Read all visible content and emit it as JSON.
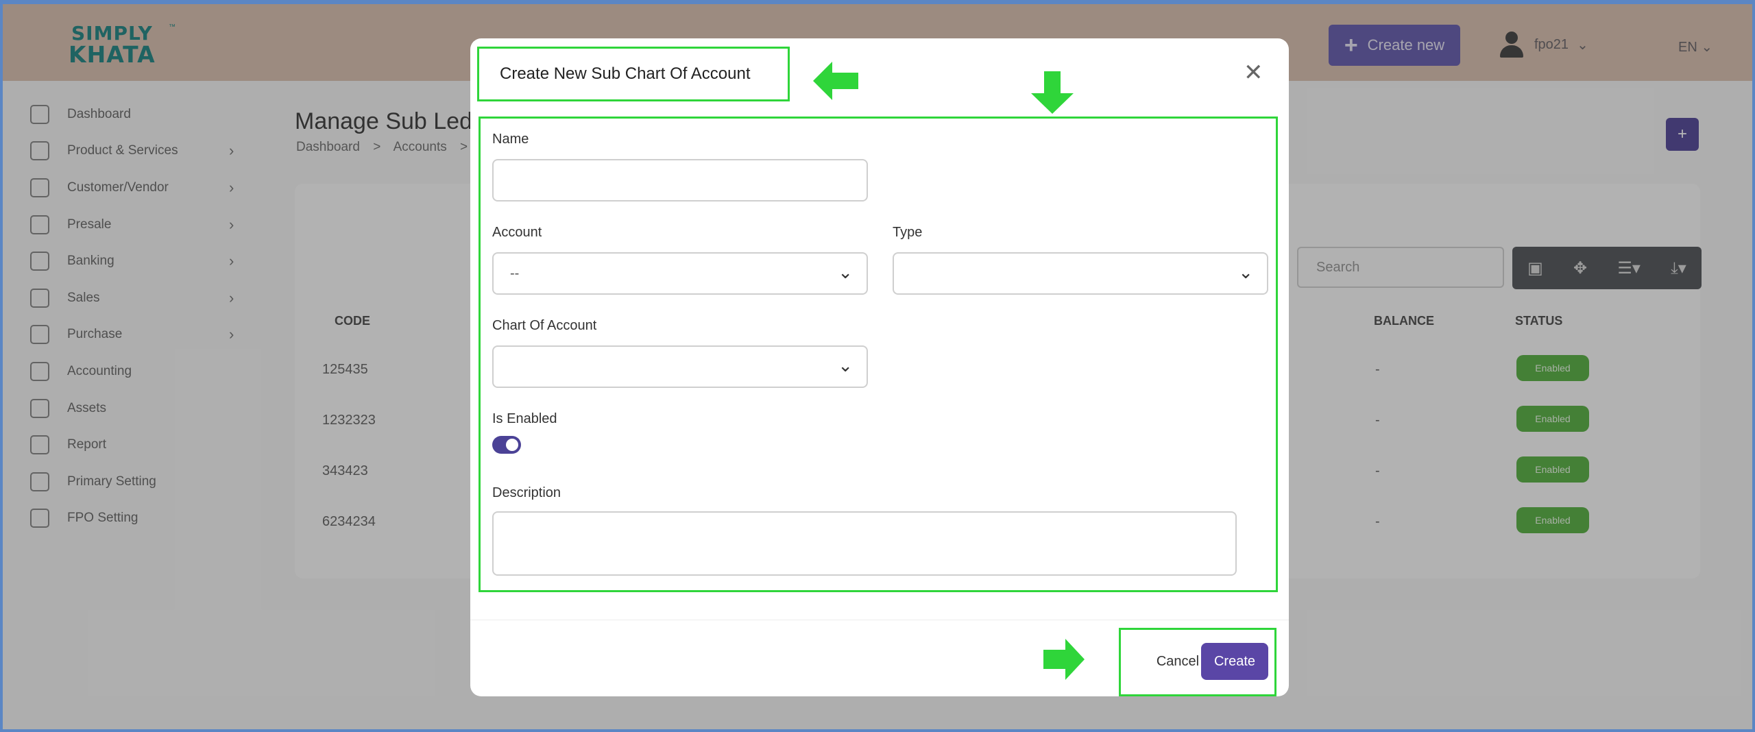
{
  "header": {
    "logo": {
      "line1": "SIMPLY",
      "line2": "KHATA",
      "tm": "™"
    },
    "create_new_label": "Create new",
    "user_name": "fpo21",
    "language": "EN",
    "accent_color": "#5c4d9c"
  },
  "sidebar": {
    "items": [
      {
        "label": "Dashboard",
        "icon": "home-icon",
        "has_children": false
      },
      {
        "label": "Product & Services",
        "icon": "cart-icon",
        "has_children": true
      },
      {
        "label": "Customer/Vendor",
        "icon": "user-add-icon",
        "has_children": true
      },
      {
        "label": "Presale",
        "icon": "briefcase-icon",
        "has_children": true
      },
      {
        "label": "Banking",
        "icon": "bank-icon",
        "has_children": true
      },
      {
        "label": "Sales",
        "icon": "document-icon",
        "has_children": true
      },
      {
        "label": "Purchase",
        "icon": "clipboard-icon",
        "has_children": true
      },
      {
        "label": "Accounting",
        "icon": "coin-icon",
        "has_children": false
      },
      {
        "label": "Assets",
        "icon": "calculator-icon",
        "has_children": false
      },
      {
        "label": "Report",
        "icon": "chart-icon",
        "has_children": false
      },
      {
        "label": "Primary Setting",
        "icon": "tag-icon",
        "has_children": false
      },
      {
        "label": "FPO Setting",
        "icon": "gear-icon",
        "has_children": false
      }
    ]
  },
  "page": {
    "title": "Manage Sub Ledg",
    "breadcrumb": [
      "Dashboard",
      ">",
      "Accounts",
      ">"
    ],
    "search_placeholder": "Search"
  },
  "table": {
    "headers": {
      "code": "CODE",
      "balance": "BALANCE",
      "status": "STATUS"
    },
    "rows": [
      {
        "code": "125435",
        "balance": "-",
        "status": "Enabled"
      },
      {
        "code": "1232323",
        "balance": "-",
        "status": "Enabled"
      },
      {
        "code": "343423",
        "balance": "-",
        "status": "Enabled"
      },
      {
        "code": "6234234",
        "balance": "-",
        "status": "Enabled"
      }
    ]
  },
  "modal": {
    "title": "Create New Sub Chart Of Account",
    "fields": {
      "name_label": "Name",
      "name_value": "",
      "account_label": "Account",
      "account_value": "--",
      "type_label": "Type",
      "type_value": "",
      "chart_label": "Chart Of Account",
      "chart_value": "",
      "enabled_label": "Is Enabled",
      "enabled_value": true,
      "description_label": "Description",
      "description_value": ""
    },
    "cancel_label": "Cancel",
    "create_label": "Create"
  },
  "annotation_color": "#2fd53a"
}
